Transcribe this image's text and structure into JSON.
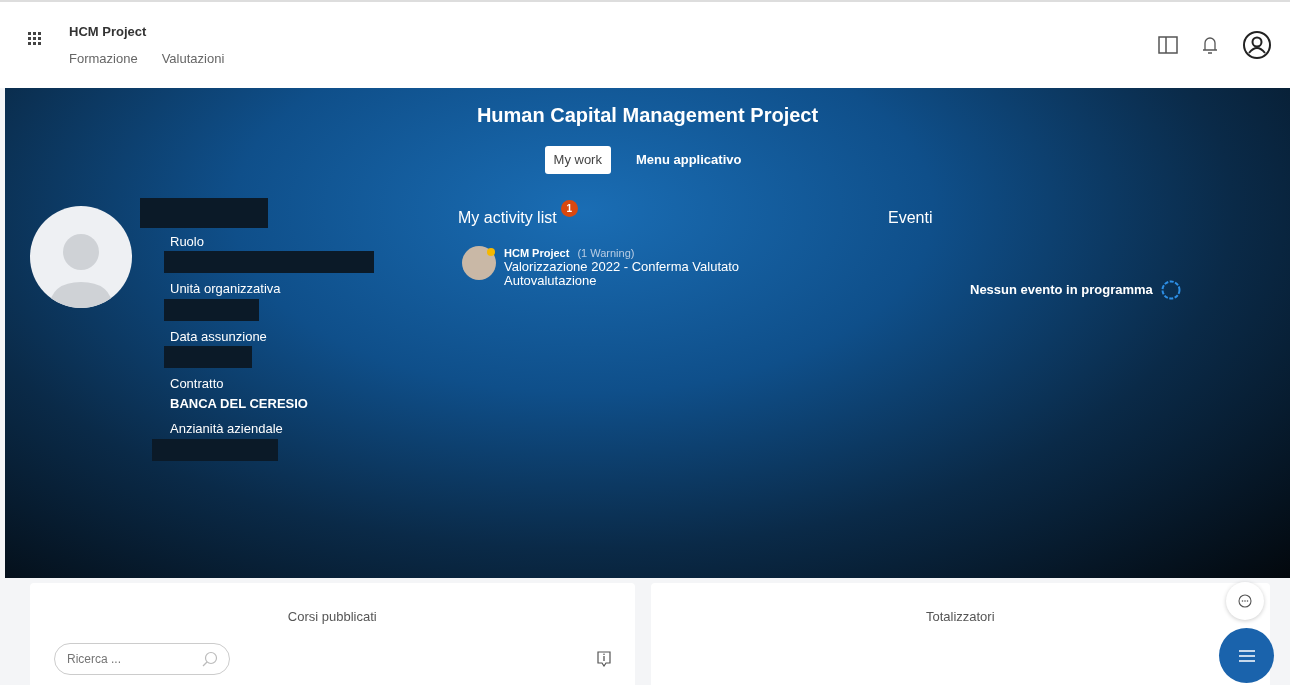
{
  "header": {
    "app_title": "HCM Project",
    "nav": [
      {
        "label": "Formazione"
      },
      {
        "label": "Valutazioni"
      }
    ]
  },
  "hero": {
    "title": "Human Capital Management Project",
    "tabs": [
      {
        "label": "My work",
        "selected": true
      },
      {
        "label": "Menu applicativo",
        "selected": false
      }
    ],
    "profile": {
      "name_redacted": true,
      "fields": [
        {
          "label": "Ruolo",
          "redacted": true
        },
        {
          "label": "Unità organizzativa",
          "redacted": true
        },
        {
          "label": "Data assunzione",
          "redacted": true
        },
        {
          "label": "Contratto",
          "value": "BANCA DEL CERESIO"
        },
        {
          "label": "Anzianità aziendale",
          "redacted": true
        }
      ]
    },
    "activity": {
      "title": "My activity list",
      "count": "1",
      "items": [
        {
          "source": "HCM Project",
          "note": "(1 Warning)",
          "text": "Valorizzazione 2022 - Conferma Valutato Autovalutazione"
        }
      ]
    },
    "events": {
      "title": "Eventi",
      "empty_text": "Nessun evento in programma"
    }
  },
  "cards": [
    {
      "title": "Corsi pubblicati",
      "search_placeholder": "Ricerca ..."
    },
    {
      "title": "Totalizzatori"
    }
  ]
}
